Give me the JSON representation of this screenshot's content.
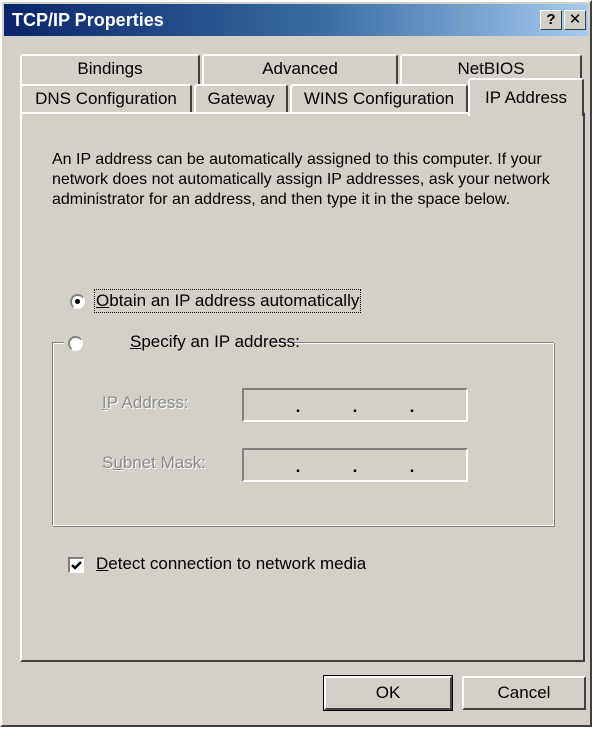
{
  "window": {
    "title": "TCP/IP Properties",
    "help_label": "?",
    "close_label": "✕"
  },
  "tabs": {
    "back_row": [
      {
        "label": "Bindings"
      },
      {
        "label": "Advanced"
      },
      {
        "label": "NetBIOS"
      }
    ],
    "front_row": [
      {
        "label": "DNS Configuration"
      },
      {
        "label": "Gateway"
      },
      {
        "label": "WINS Configuration"
      },
      {
        "label": "IP Address",
        "active": true
      }
    ]
  },
  "ip_page": {
    "description": "An IP address can be automatically assigned to this computer. If your network does not automatically assign IP addresses, ask your network administrator for an address, and then type it in the space below.",
    "obtain_auto": {
      "accel": "O",
      "rest": "btain an IP address automatically",
      "selected": true
    },
    "specify": {
      "accel": "S",
      "rest": "pecify an IP address:",
      "selected": false
    },
    "ip_address": {
      "pre": "",
      "accel": "I",
      "rest": "P Address:",
      "octets": [
        "",
        "",
        "",
        ""
      ]
    },
    "subnet_mask": {
      "pre": "S",
      "accel": "u",
      "rest": "bnet Mask:",
      "octets": [
        "",
        "",
        "",
        ""
      ]
    },
    "detect_media": {
      "accel": "D",
      "rest": "etect connection to network media",
      "checked": true
    }
  },
  "buttons": {
    "ok_label": "OK",
    "cancel_label": "Cancel"
  },
  "colors": {
    "face": "#d4d0c8",
    "title_start": "#0a246a",
    "title_end": "#a6caf0",
    "disabled_text": "#8c8c8c"
  }
}
